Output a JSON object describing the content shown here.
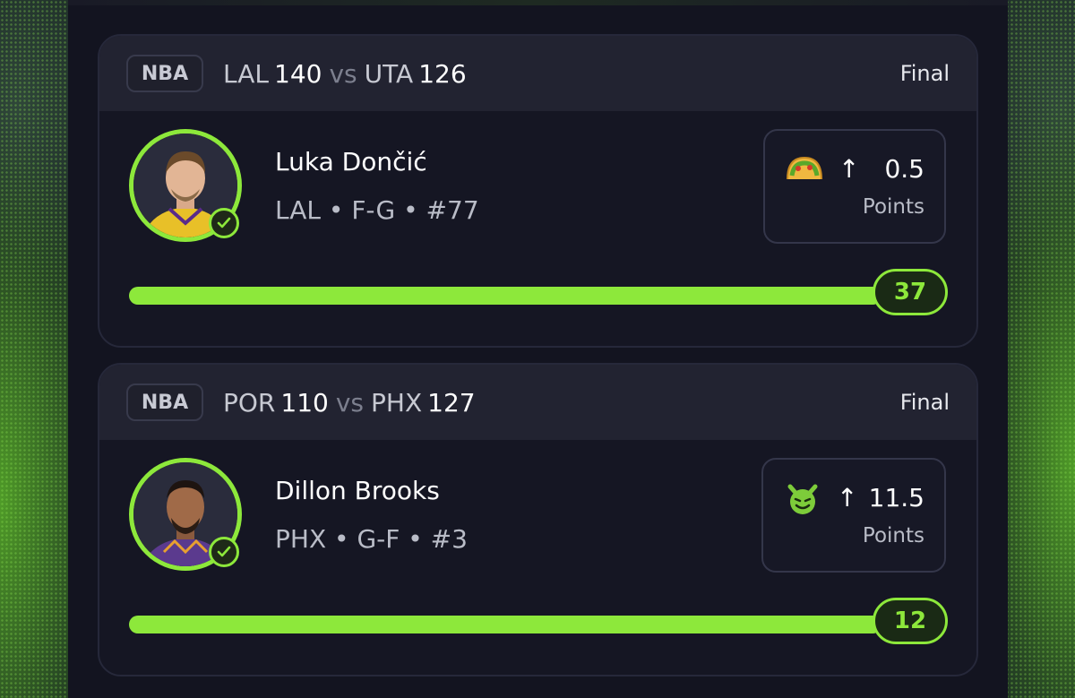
{
  "colors": {
    "accent": "#8de83b",
    "card_bg": "#151623",
    "header_bg": "#222331"
  },
  "cards": [
    {
      "league": "NBA",
      "team1": "LAL",
      "score1": "140",
      "vs": "vs",
      "team2": "UTA",
      "score2": "126",
      "status": "Final",
      "player": {
        "name": "Luka Dončić",
        "meta": "LAL • F-G • #77",
        "avatar_icon": "player-headshot-icon",
        "verified_icon": "check-circle-icon"
      },
      "line": {
        "emoji_icon": "taco-icon",
        "direction_icon": "arrow-up-icon",
        "arrow": "↑",
        "value": "0.5",
        "label": "Points"
      },
      "result": "37",
      "progress_fraction": 1.0
    },
    {
      "league": "NBA",
      "team1": "POR",
      "score1": "110",
      "vs": "vs",
      "team2": "PHX",
      "score2": "127",
      "status": "Final",
      "player": {
        "name": "Dillon Brooks",
        "meta": "PHX • G-F • #3",
        "avatar_icon": "player-headshot-icon",
        "verified_icon": "check-circle-icon"
      },
      "line": {
        "emoji_icon": "devil-face-icon",
        "direction_icon": "arrow-up-icon",
        "arrow": "↑",
        "value": "11.5",
        "label": "Points"
      },
      "result": "12",
      "progress_fraction": 1.0
    }
  ]
}
